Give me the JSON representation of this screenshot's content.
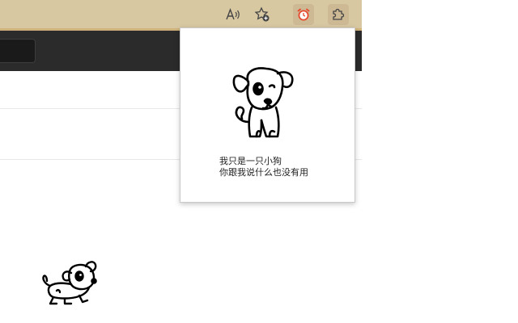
{
  "toolbar": {
    "buttons": [
      {
        "id": "read-aloud",
        "icon": "read-aloud-icon",
        "tooltip": "Read aloud"
      },
      {
        "id": "add-favorite",
        "icon": "star-add-icon",
        "tooltip": "Add to favorites"
      },
      {
        "id": "alarm-extension",
        "icon": "alarm-clock-icon",
        "tooltip": "Extension"
      },
      {
        "id": "extensions",
        "icon": "puzzle-icon",
        "tooltip": "Extensions"
      }
    ],
    "colors": {
      "bg": "#d8c8a2",
      "accent": "#cfb37a",
      "alarm": "#e64a2e"
    }
  },
  "popup": {
    "image": "sketch-dog",
    "line1": "我只是一只小狗",
    "line2": "你跟我说什么也没有用"
  },
  "page": {
    "pet": "running-sketch-dog",
    "colors": {
      "dark_bar": "#2b2b2b",
      "background": "#ffffff"
    }
  }
}
